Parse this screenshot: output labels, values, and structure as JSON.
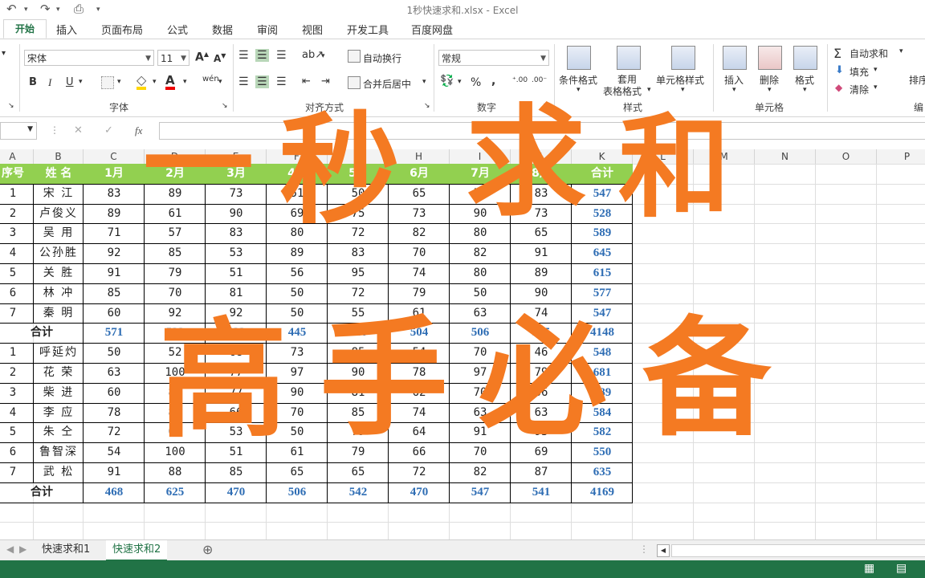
{
  "window": {
    "title": "1秒快速求和.xlsx - Excel"
  },
  "tabs": [
    "开始",
    "插入",
    "页面布局",
    "公式",
    "数据",
    "审阅",
    "视图",
    "开发工具",
    "百度网盘"
  ],
  "ribbon": {
    "font_name": "宋体",
    "font_size": "11",
    "number_format": "常规",
    "wrap_text": "自动换行",
    "merge_center": "合并后居中",
    "cond_format": "条件格式",
    "table_format": [
      "套用",
      "表格格式"
    ],
    "cell_style": "单元格样式",
    "insert": "插入",
    "delete": "删除",
    "format": "格式",
    "autosum": "自动求和",
    "fill": "填充",
    "clear": "清除",
    "sort": "排序",
    "groups": {
      "font": "字体",
      "align": "对齐方式",
      "number": "数字",
      "styles": "样式",
      "cells": "单元格",
      "edit": "编"
    },
    "bold": "B",
    "italic": "I",
    "underline": "U",
    "percent": "%",
    "comma": ",",
    "wen": "wén"
  },
  "formula_bar": {
    "fx": "fx",
    "cancel": "✕",
    "enter": "✓"
  },
  "columns": [
    "A",
    "B",
    "C",
    "D",
    "E",
    "F",
    "G",
    "H",
    "I",
    "J",
    "K",
    "L",
    "M",
    "N",
    "O",
    "P"
  ],
  "header_row": [
    "序号",
    "姓  名",
    "1月",
    "2月",
    "3月",
    "4月",
    "5月",
    "6月",
    "7月",
    "8月",
    "合计"
  ],
  "block1": [
    [
      "1",
      "宋  江",
      "83",
      "89",
      "73",
      "51",
      "50",
      "65",
      "53",
      "83",
      "547"
    ],
    [
      "2",
      "卢俊义",
      "89",
      "61",
      "90",
      "69",
      "75",
      "73",
      "90",
      "73",
      "528"
    ],
    [
      "3",
      "吴  用",
      "71",
      "57",
      "83",
      "80",
      "72",
      "82",
      "80",
      "65",
      "589"
    ],
    [
      "4",
      "公孙胜",
      "92",
      "85",
      "53",
      "89",
      "83",
      "70",
      "82",
      "91",
      "645"
    ],
    [
      "5",
      "关  胜",
      "91",
      "79",
      "51",
      "56",
      "95",
      "74",
      "80",
      "89",
      "615"
    ],
    [
      "6",
      "林  冲",
      "85",
      "70",
      "81",
      "50",
      "72",
      "79",
      "50",
      "90",
      "577"
    ],
    [
      "7",
      "秦  明",
      "60",
      "92",
      "92",
      "50",
      "55",
      "61",
      "63",
      "74",
      "547"
    ]
  ],
  "total1": [
    "合计",
    "571",
    "533",
    "523",
    "445",
    "440",
    "504",
    "506",
    "575",
    "4148"
  ],
  "block2": [
    [
      "1",
      "呼延灼",
      "50",
      "52",
      "68",
      "73",
      "85",
      "54",
      "70",
      "46",
      "548"
    ],
    [
      "2",
      "花  荣",
      "63",
      "100",
      "77",
      "97",
      "90",
      "78",
      "97",
      "79",
      "681"
    ],
    [
      "3",
      "柴  进",
      "60",
      "80",
      "77",
      "90",
      "81",
      "62",
      "70",
      "36",
      "589"
    ],
    [
      "4",
      "李  应",
      "78",
      "85",
      "66",
      "70",
      "85",
      "74",
      "63",
      "63",
      "584"
    ],
    [
      "5",
      "朱  仝",
      "72",
      "68",
      "53",
      "50",
      "79",
      "64",
      "91",
      "93",
      "582"
    ],
    [
      "6",
      "鲁智深",
      "54",
      "100",
      "51",
      "61",
      "79",
      "66",
      "70",
      "69",
      "550"
    ],
    [
      "7",
      "武  松",
      "91",
      "88",
      "85",
      "65",
      "65",
      "72",
      "82",
      "87",
      "635"
    ]
  ],
  "total2": [
    "合计",
    "468",
    "625",
    "470",
    "506",
    "542",
    "470",
    "547",
    "541",
    "4169"
  ],
  "overlay": {
    "line1": [
      "一",
      "秒",
      "求",
      "和"
    ],
    "line2": [
      "高",
      "手",
      "必",
      "备"
    ]
  },
  "sheets": [
    "快速求和1",
    "快速求和2"
  ],
  "colors": {
    "accent": "#217346",
    "header_fill": "#92d050",
    "sum_text": "#2e6db4",
    "overlay": "#f47a22"
  }
}
